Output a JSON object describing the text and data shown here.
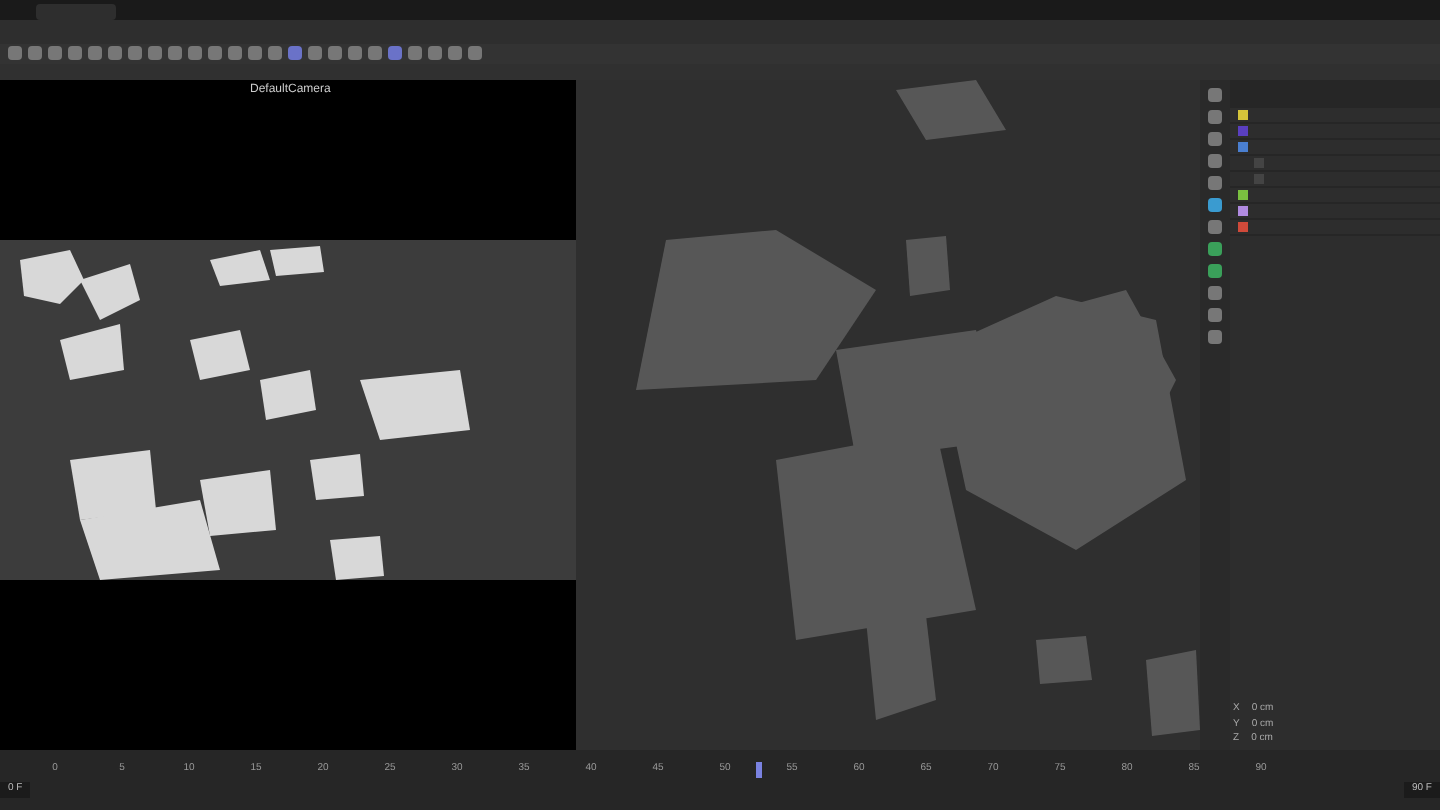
{
  "viewport_left": {
    "camera_label": "DefaultCamera"
  },
  "objects": [
    {
      "color": "#d4c43a"
    },
    {
      "color": "#5a3fc0"
    },
    {
      "color": "#4a7fd0",
      "children": [
        {
          "color": "#444444"
        },
        {
          "color": "#444444"
        }
      ]
    },
    {
      "color": "#7ac040"
    },
    {
      "color": "#b08ae0"
    },
    {
      "color": "#d04a3a"
    }
  ],
  "coordinates": {
    "axes": [
      "X",
      "Y",
      "Z"
    ],
    "values": [
      "0 cm",
      "0 cm",
      "0 cm"
    ]
  },
  "timeline": {
    "ticks": [
      "0",
      "5",
      "10",
      "15",
      "20",
      "25",
      "30",
      "35",
      "40",
      "45",
      "50",
      "55",
      "60",
      "65",
      "70",
      "75",
      "80",
      "85",
      "90"
    ],
    "level": 0.56,
    "start": "0 F",
    "end": "90 F"
  }
}
